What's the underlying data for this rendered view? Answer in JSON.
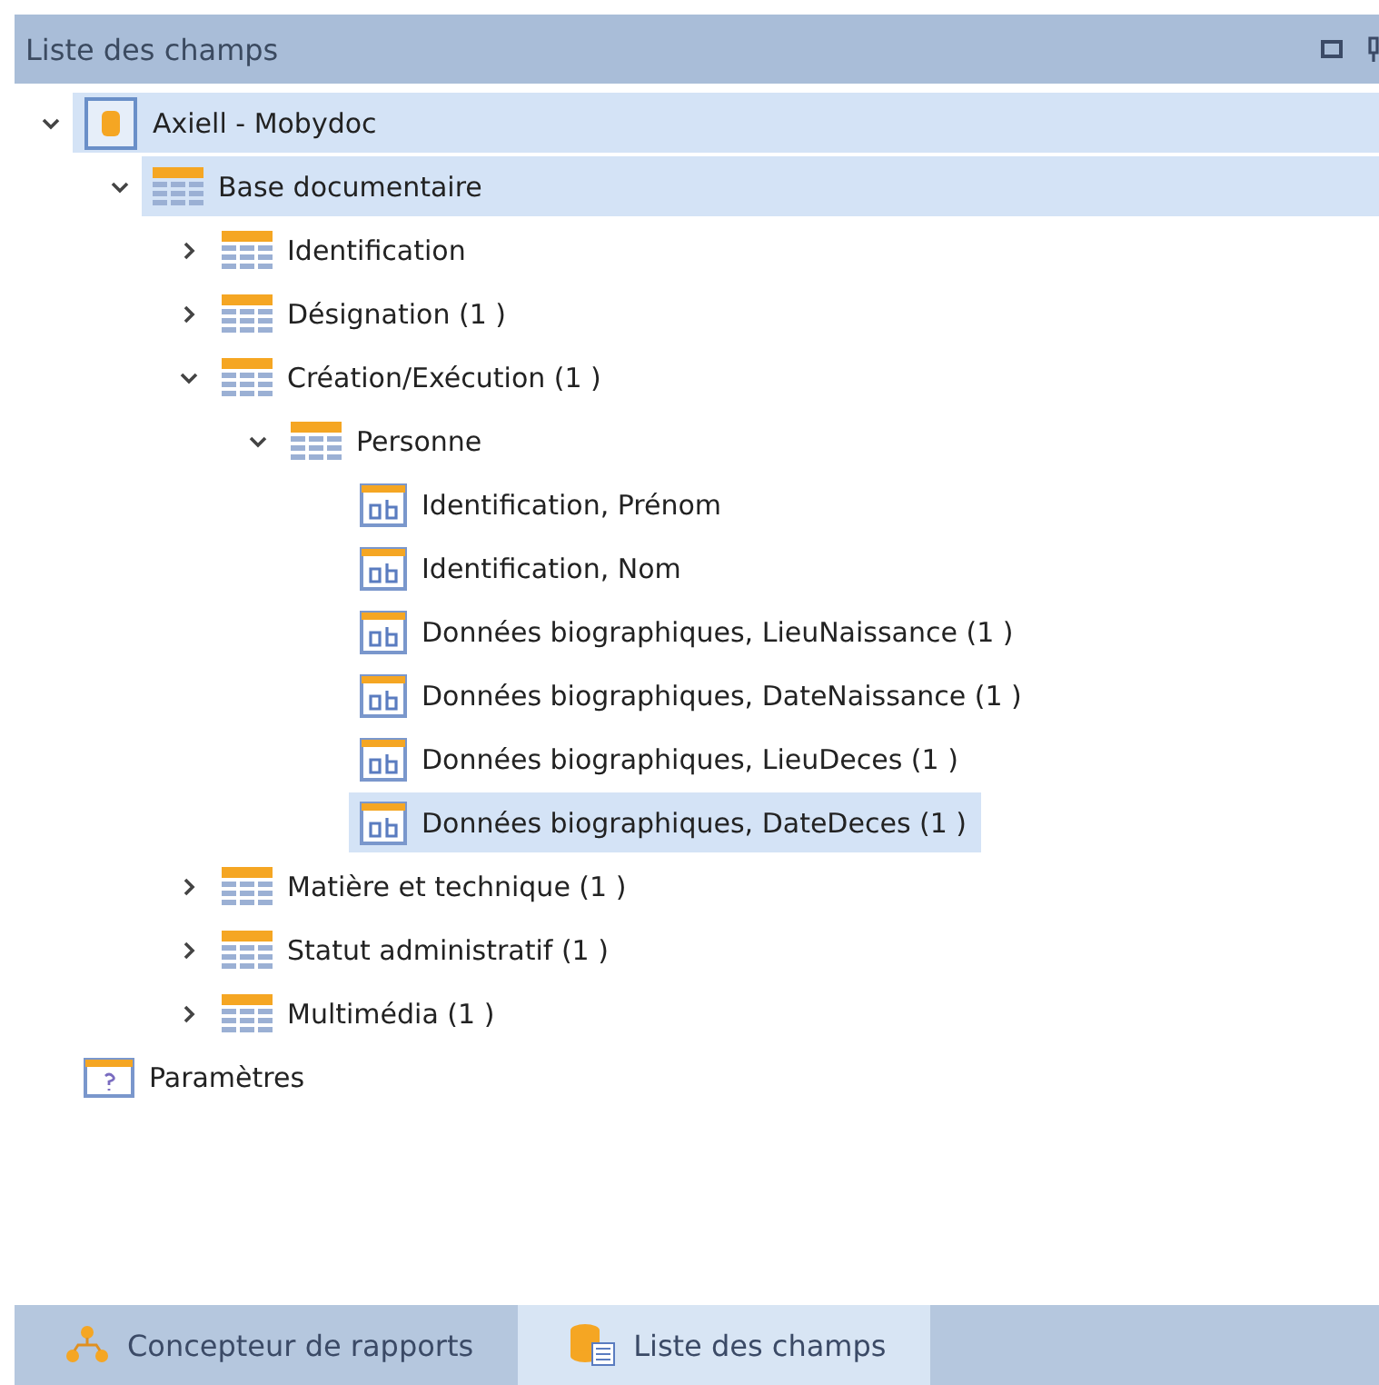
{
  "panel": {
    "title": "Liste des champs"
  },
  "tree": [
    {
      "kind": "root",
      "label": "Axiell - Mobydoc",
      "expanded": true,
      "selected": true,
      "children": [
        {
          "kind": "table",
          "label": "Base documentaire",
          "expanded": true,
          "selected": true,
          "children": [
            {
              "kind": "table",
              "label": "Identification",
              "expanded": false,
              "selected": false
            },
            {
              "kind": "table",
              "label": "Désignation (1 )",
              "expanded": false,
              "selected": false
            },
            {
              "kind": "table",
              "label": "Création/Exécution (1 )",
              "expanded": true,
              "selected": false,
              "children": [
                {
                  "kind": "table",
                  "label": "Personne",
                  "expanded": true,
                  "selected": false,
                  "children": [
                    {
                      "kind": "field",
                      "label": "Identification, Prénom",
                      "selected": false
                    },
                    {
                      "kind": "field",
                      "label": "Identification, Nom",
                      "selected": false
                    },
                    {
                      "kind": "field",
                      "label": "Données biographiques, LieuNaissance (1 )",
                      "selected": false
                    },
                    {
                      "kind": "field",
                      "label": "Données biographiques, DateNaissance (1 )",
                      "selected": false
                    },
                    {
                      "kind": "field",
                      "label": "Données biographiques, LieuDeces (1 )",
                      "selected": false
                    },
                    {
                      "kind": "field",
                      "label": "Données biographiques, DateDeces (1 )",
                      "selected": true
                    }
                  ]
                }
              ]
            },
            {
              "kind": "table",
              "label": "Matière et technique (1 )",
              "expanded": false,
              "selected": false
            },
            {
              "kind": "table",
              "label": "Statut administratif (1 )",
              "expanded": false,
              "selected": false
            },
            {
              "kind": "table",
              "label": "Multimédia (1 )",
              "expanded": false,
              "selected": false
            }
          ]
        }
      ]
    },
    {
      "kind": "param",
      "label": "Paramètres",
      "selected": false
    }
  ],
  "tabs": [
    {
      "kind": "designer",
      "label": "Concepteur de rapports",
      "selected": false
    },
    {
      "kind": "fields",
      "label": "Liste des champs",
      "selected": true
    }
  ]
}
